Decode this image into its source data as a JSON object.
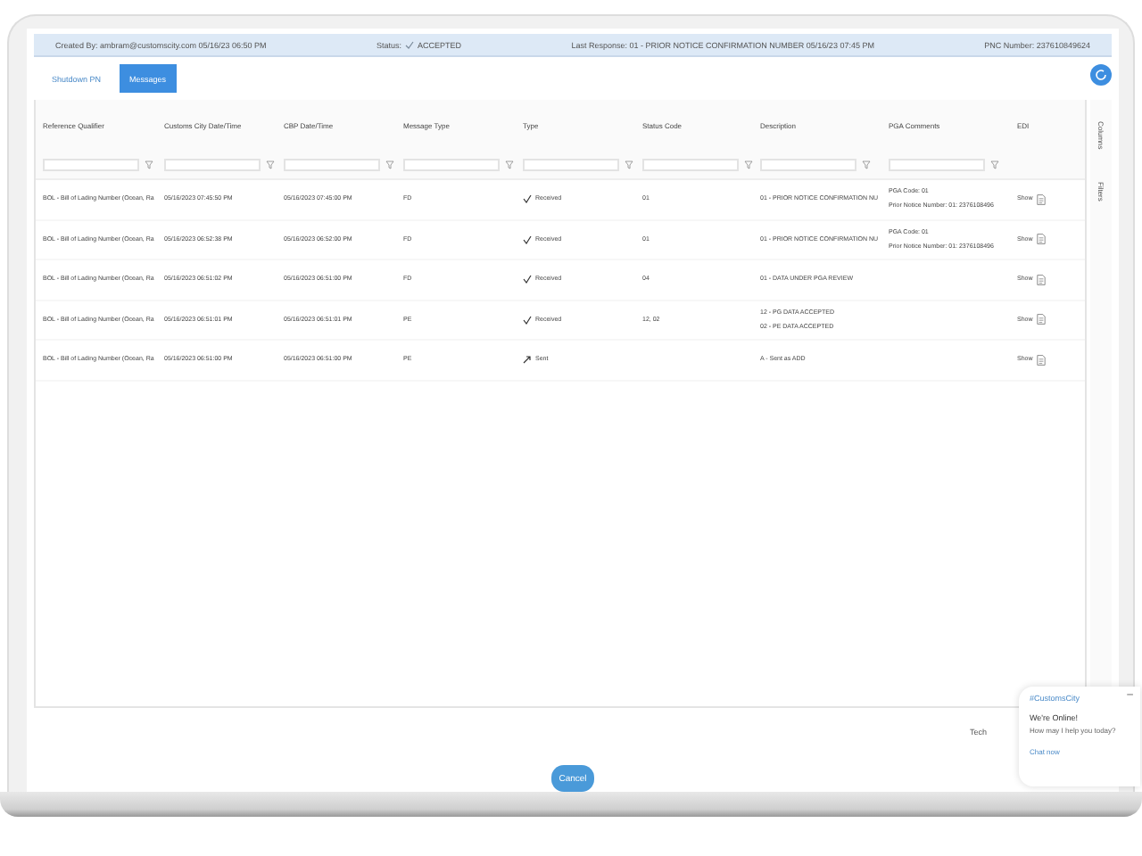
{
  "header": {
    "created_by": "Created By: ambram@customscity.com 05/16/23 06:50 PM",
    "status_label": "Status:",
    "status": "ACCEPTED",
    "last_response": "Last Response: 01 - PRIOR NOTICE CONFIRMATION NUMBER 05/16/23 07:45 PM",
    "pnc_number": "PNC Number: 237610849624"
  },
  "tabs": [
    {
      "label": "Shutdown PN",
      "selected": false
    },
    {
      "label": "Messages",
      "selected": true
    }
  ],
  "table": {
    "columns": [
      {
        "label": "Reference Qualifier",
        "filter": true
      },
      {
        "label": "Customs City Date/Time",
        "filter": true
      },
      {
        "label": "CBP Date/Time",
        "filter": true
      },
      {
        "label": "Message Type",
        "filter": true
      },
      {
        "label": "Type",
        "filter": true
      },
      {
        "label": "Status Code",
        "filter": true
      },
      {
        "label": "Description",
        "filter": true
      },
      {
        "label": "PGA Comments",
        "filter": true
      },
      {
        "label": "EDI",
        "filter": false
      }
    ],
    "rows": [
      {
        "reference": "BOL - Bill of Lading Number (Ocean, Ra",
        "cc_time": "05/16/2023 07:45:50 PM",
        "cbp_time": "05/16/2023 07:45:00 PM",
        "message_type": "FD",
        "type": {
          "kind": "received",
          "label": "Received"
        },
        "status_code": "01",
        "description": [
          "01 - PRIOR NOTICE CONFIRMATION NU"
        ],
        "pga_comments": [
          "PGA Code: 01",
          "Prior Notice Number: 01: 2376108496"
        ],
        "edi": "Show"
      },
      {
        "reference": "BOL - Bill of Lading Number (Ocean, Ra",
        "cc_time": "05/16/2023 06:52:38 PM",
        "cbp_time": "05/16/2023 06:52:00 PM",
        "message_type": "FD",
        "type": {
          "kind": "received",
          "label": "Received"
        },
        "status_code": "01",
        "description": [
          "01 - PRIOR NOTICE CONFIRMATION NU"
        ],
        "pga_comments": [
          "PGA Code: 01",
          "Prior Notice Number: 01: 2376108496"
        ],
        "edi": "Show"
      },
      {
        "reference": "BOL - Bill of Lading Number (Ocean, Ra",
        "cc_time": "05/16/2023 06:51:02 PM",
        "cbp_time": "05/16/2023 06:51:00 PM",
        "message_type": "FD",
        "type": {
          "kind": "received",
          "label": "Received"
        },
        "status_code": "04",
        "description": [
          "01 - DATA UNDER PGA REVIEW"
        ],
        "pga_comments": [],
        "edi": "Show"
      },
      {
        "reference": "BOL - Bill of Lading Number (Ocean, Ra",
        "cc_time": "05/16/2023 06:51:01 PM",
        "cbp_time": "05/16/2023 06:51:01 PM",
        "message_type": "PE",
        "type": {
          "kind": "received",
          "label": "Received"
        },
        "status_code": "12, 02",
        "description": [
          "12 - PG DATA ACCEPTED",
          "02 - PE DATA ACCEPTED"
        ],
        "pga_comments": [],
        "edi": "Show"
      },
      {
        "reference": "BOL - Bill of Lading Number (Ocean, Ra",
        "cc_time": "05/16/2023 06:51:00 PM",
        "cbp_time": "05/16/2023 06:51:00 PM",
        "message_type": "PE",
        "type": {
          "kind": "sent",
          "label": "Sent"
        },
        "status_code": "",
        "description": [
          "A - Sent as ADD"
        ],
        "pga_comments": [],
        "edi": "Show"
      }
    ]
  },
  "side_tabs": [
    "Columns",
    "Filters"
  ],
  "footer_text": "Tech",
  "cancel_button": "Cancel",
  "chat": {
    "brand": "#CustomsCity",
    "title": "We're Online!",
    "message": "How may I help you today?",
    "link": "Chat now",
    "minimize": "–"
  }
}
